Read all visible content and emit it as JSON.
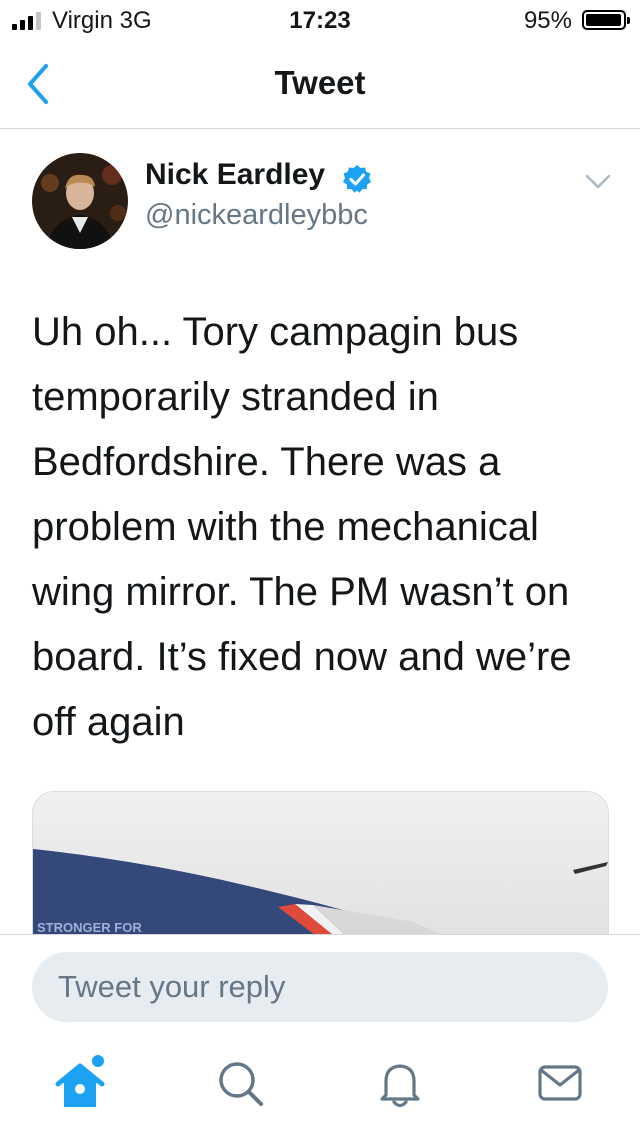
{
  "status_bar": {
    "carrier": "Virgin 3G",
    "time": "17:23",
    "battery": "95%"
  },
  "nav": {
    "title": "Tweet"
  },
  "tweet": {
    "author_name": "Nick Eardley",
    "handle": "@nickeardleybbc",
    "text": "Uh oh... Tory campagin bus temporarily stranded in Bedfordshire. There was a problem with the mechanical wing mirror. The PM wasn’t on board. It’s fixed now and we’re off again",
    "media_text": "STRONGER FOR"
  },
  "reply": {
    "placeholder": "Tweet your reply"
  },
  "colors": {
    "accent": "#1da1f2",
    "secondary_text": "#657786",
    "input_bg": "#e6ecf0"
  }
}
